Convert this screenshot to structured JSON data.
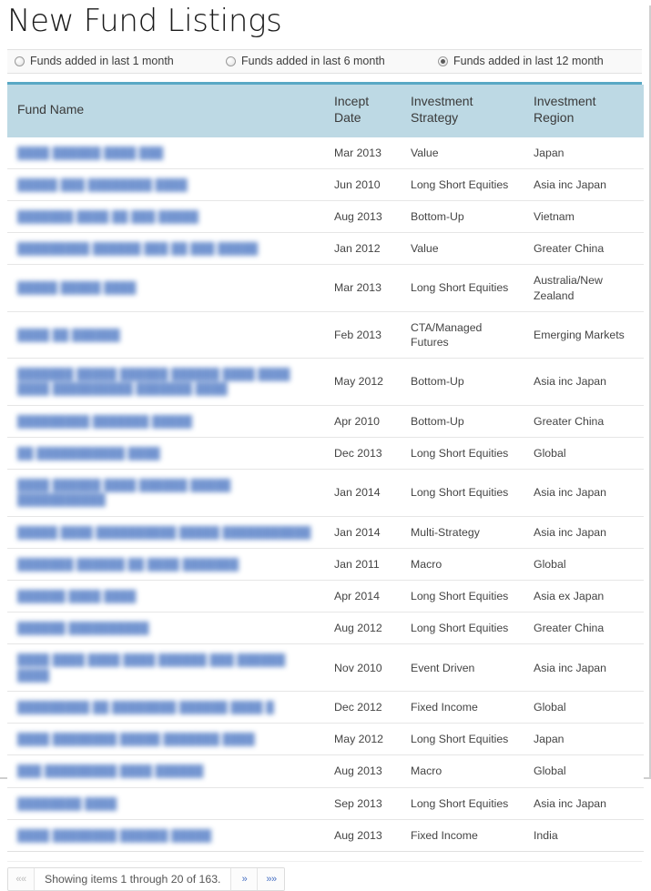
{
  "header": {
    "title": "New Fund Listings"
  },
  "filters": {
    "options": [
      {
        "label": "Funds added in last 1 month",
        "selected": false
      },
      {
        "label": "Funds added in last 6 month",
        "selected": false
      },
      {
        "label": "Funds added in last 12 month",
        "selected": true
      }
    ]
  },
  "table": {
    "columns": [
      {
        "key": "name",
        "label": "Fund Name"
      },
      {
        "key": "date",
        "label": "Incept Date"
      },
      {
        "key": "strategy",
        "label": "Investment Strategy"
      },
      {
        "key": "region",
        "label": "Investment Region"
      }
    ],
    "rows": [
      {
        "name": "████ ██████ ████ ███",
        "date": "Mar 2013",
        "strategy": "Value",
        "region": "Japan"
      },
      {
        "name": "█████ ███ ████████ ████",
        "date": "Jun 2010",
        "strategy": "Long Short Equities",
        "region": "Asia inc Japan"
      },
      {
        "name": "███████ ████ ██ ███ █████",
        "date": "Aug 2013",
        "strategy": "Bottom-Up",
        "region": "Vietnam"
      },
      {
        "name": "█████████ ██████ ███ ██ ███ █████",
        "date": "Jan 2012",
        "strategy": "Value",
        "region": "Greater China"
      },
      {
        "name": "█████ █████ ████",
        "date": "Mar 2013",
        "strategy": "Long Short Equities",
        "region": "Australia/New Zealand"
      },
      {
        "name": "████ ██ ██████",
        "date": "Feb 2013",
        "strategy": "CTA/Managed Futures",
        "region": "Emerging Markets"
      },
      {
        "name": "███████ █████ ██████ ██████  ████ ████ ████ ██████████ ███████ ████",
        "date": "May 2012",
        "strategy": "Bottom-Up",
        "region": "Asia inc Japan"
      },
      {
        "name": "█████████ ███████ █████",
        "date": "Apr 2010",
        "strategy": "Bottom-Up",
        "region": "Greater China"
      },
      {
        "name": "██ ███████████ ████",
        "date": "Dec 2013",
        "strategy": "Long Short Equities",
        "region": "Global"
      },
      {
        "name": "████ ██████ ████ ██████ █████ ███████████",
        "date": "Jan 2014",
        "strategy": "Long Short Equities",
        "region": "Asia inc Japan"
      },
      {
        "name": "█████ ████ ██████████ █████ ███████████",
        "date": "Jan 2014",
        "strategy": "Multi-Strategy",
        "region": "Asia inc Japan"
      },
      {
        "name": "███████ ██████ ██ ████ ███████",
        "date": "Jan 2011",
        "strategy": "Macro",
        "region": "Global"
      },
      {
        "name": "██████ ████ ████",
        "date": "Apr 2014",
        "strategy": "Long Short Equities",
        "region": "Asia ex Japan"
      },
      {
        "name": "██████ ██████████",
        "date": "Aug 2012",
        "strategy": "Long Short Equities",
        "region": "Greater China"
      },
      {
        "name": "████ ████ ████ ████ ██████ ███ ██████ ████",
        "date": "Nov 2010",
        "strategy": "Event Driven",
        "region": "Asia inc Japan"
      },
      {
        "name": "█████████ ██ ████████ ██████ ████ █",
        "date": "Dec 2012",
        "strategy": "Fixed Income",
        "region": "Global"
      },
      {
        "name": "████ ████████ █████ ███████ ████",
        "date": "May 2012",
        "strategy": "Long Short Equities",
        "region": "Japan"
      },
      {
        "name": "███ █████████ ████ ██████",
        "date": "Aug 2013",
        "strategy": "Macro",
        "region": "Global"
      },
      {
        "name": "████████ ████",
        "date": "Sep 2013",
        "strategy": "Long Short Equities",
        "region": "Asia inc Japan"
      },
      {
        "name": "████ ████████ ██████ █████",
        "date": "Aug 2013",
        "strategy": "Fixed Income",
        "region": "India"
      }
    ]
  },
  "pagination": {
    "first_label": "««",
    "status": "Showing items 1 through 20 of 163.",
    "next_label": "»",
    "last_label": "»»",
    "first_disabled": true
  },
  "colors": {
    "header_fill": "#bdd9e4",
    "header_top_border": "#58a8c4",
    "link": "#5a82c8",
    "filter_bar_bg": "#f9f9f9"
  }
}
